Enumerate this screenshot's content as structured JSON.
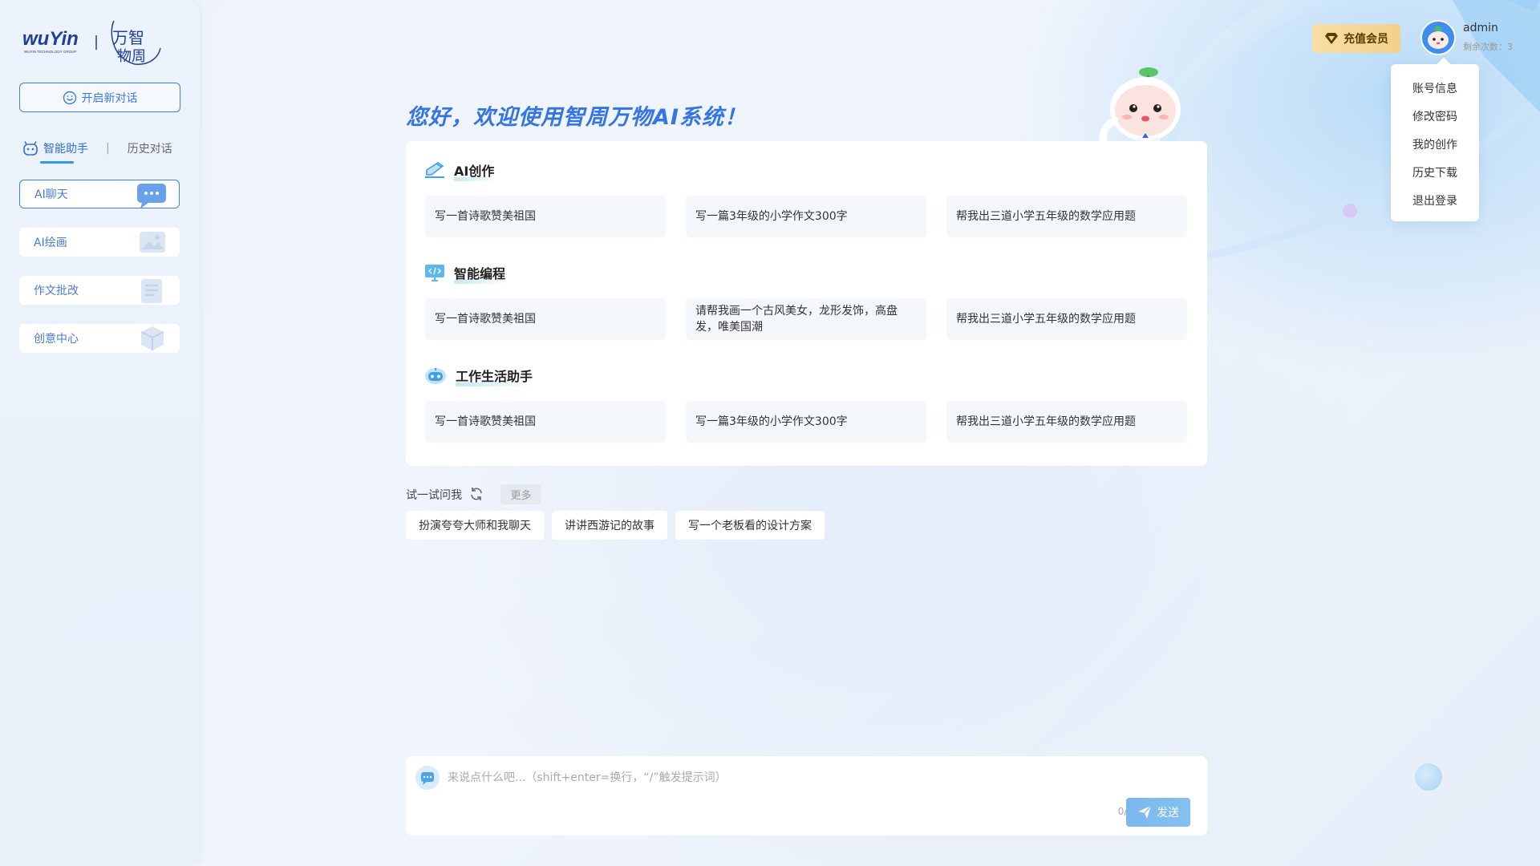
{
  "brand": {
    "logo_text_left": "wuYin",
    "logo_subtext": "WUYIN TECHNOLOGY GROUP",
    "logo_text_right": "万智物周"
  },
  "sidebar": {
    "new_chat_label": "开启新对话",
    "tabs": [
      {
        "label": "智能助手",
        "active": true
      },
      {
        "label": "历史对话",
        "active": false
      }
    ],
    "tab_separator": "|",
    "items": [
      {
        "label": "AI聊天",
        "active": true,
        "icon": "chat-bubble-icon"
      },
      {
        "label": "AI绘画",
        "active": false,
        "icon": "image-icon"
      },
      {
        "label": "作文批改",
        "active": false,
        "icon": "document-icon"
      },
      {
        "label": "创意中心",
        "active": false,
        "icon": "cube-icon"
      }
    ]
  },
  "header": {
    "vip_label": "充值会员",
    "username": "admin",
    "remaining_label": "剩余次数：3"
  },
  "user_menu": {
    "items": [
      "账号信息",
      "修改密码",
      "我的创作",
      "历史下载",
      "退出登录"
    ]
  },
  "main": {
    "welcome": "您好，欢迎使用智周万物AI系统！",
    "sections": [
      {
        "title": "AI创作",
        "icon": "edit-pen-icon",
        "cards": [
          "写一首诗歌赞美祖国",
          "写一篇3年级的小学作文300字",
          "帮我出三道小学五年级的数学应用题"
        ]
      },
      {
        "title": "智能编程",
        "icon": "code-monitor-icon",
        "cards": [
          "写一首诗歌赞美祖国",
          "请帮我画一个古风美女，龙形发饰，高盘发，唯美国潮",
          "帮我出三道小学五年级的数学应用题"
        ]
      },
      {
        "title": "工作生活助手",
        "icon": "robot-icon",
        "cards": [
          "写一首诗歌赞美祖国",
          "写一篇3年级的小学作文300字",
          "帮我出三道小学五年级的数学应用题"
        ]
      }
    ],
    "try_label": "试一试问我",
    "more_label": "更多",
    "suggestions": [
      "扮演夸夸大师和我聊天",
      "讲讲西游记的故事",
      "写一个老板看的设计方案"
    ]
  },
  "composer": {
    "placeholder": "来说点什么吧...（shift+enter=换行，“/”触发提示词）",
    "counter": "0/2000",
    "send_label": "发送"
  },
  "colors": {
    "accent": "#3474e5",
    "vip": "#f2d18b",
    "send": "#7ab7ee"
  }
}
